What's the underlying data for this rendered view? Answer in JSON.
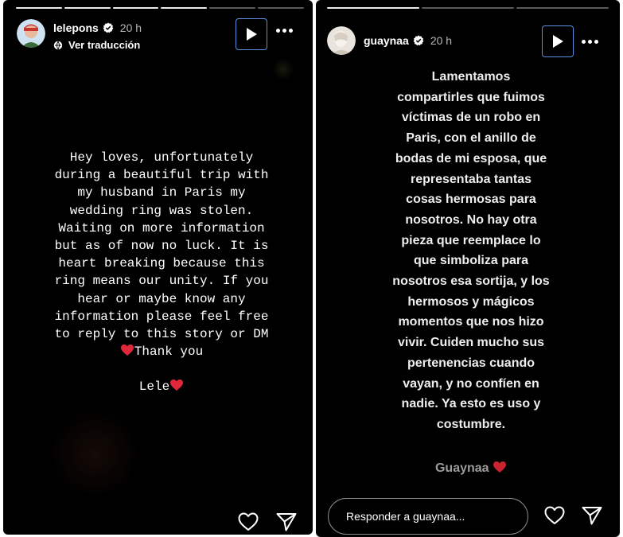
{
  "colors": {
    "background": "#000000",
    "text": "#ffffff",
    "heart": "#e0283c",
    "focus_outline": "#5b8fe0",
    "signature_right": "#9b9b9b"
  },
  "left_story": {
    "username": "lelepons",
    "time_ago": "20 h",
    "translate_label": "Ver traducción",
    "icons": [
      "verified-badge-icon",
      "translate-icon",
      "play-icon",
      "more-options-icon",
      "heart-icon",
      "send-icon"
    ],
    "progress_segments": 6,
    "progress_done": 4,
    "message_lines": [
      "Hey loves, unfortunately",
      "during a beautiful trip with",
      "my husband in Paris my",
      "wedding ring was stolen.",
      "Waiting on more information",
      "but as of now no luck. It is",
      "heart breaking because this",
      "ring means our unity. If you",
      "hear or maybe know any",
      "information please feel free",
      "to reply to this story or DM",
      "Thank you"
    ],
    "signature": "Lele"
  },
  "right_story": {
    "username": "guaynaa",
    "time_ago": "20 h",
    "icons": [
      "verified-badge-icon",
      "play-icon",
      "more-options-icon",
      "heart-icon",
      "send-icon"
    ],
    "progress_segments": 3,
    "progress_done": 1,
    "message_lines": [
      "Lamentamos",
      "compartirles que fuimos",
      "víctimas de un robo en",
      "Paris, con el anillo de",
      "bodas de mi esposa, que",
      "representaba tantas",
      "cosas hermosas para",
      "nosotros. No hay otra",
      "pieza que reemplace lo",
      "que simboliza para",
      "nosotros esa sortija, y los",
      "hermosos y mágicos",
      "momentos que nos hizo",
      "vivir. Cuiden mucho sus",
      "pertenencias cuando",
      "vayan, y no confíen en",
      "nadie. Ya esto es uso y",
      "costumbre."
    ],
    "signature": "Guaynaa",
    "reply_placeholder": "Responder a guaynaa..."
  }
}
